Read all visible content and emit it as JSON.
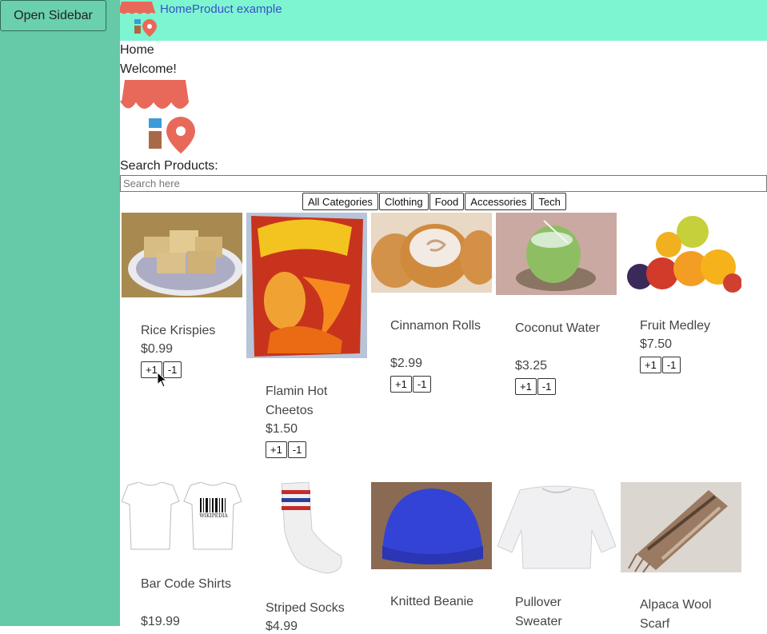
{
  "sidebar": {
    "open_label": "Open Sidebar"
  },
  "header": {
    "title": "HomeProduct example"
  },
  "main": {
    "breadcrumb": "Home",
    "welcome": "Welcome!",
    "search_label": "Search Products:",
    "search_placeholder": "Search here",
    "search_value": ""
  },
  "categories": [
    "All Categories",
    "Clothing",
    "Food",
    "Accessories",
    "Tech"
  ],
  "products": [
    {
      "name": "Rice Krispies",
      "price": "$0.99",
      "plus": "+1",
      "minus": "-1",
      "image": "rice-krispies-photo"
    },
    {
      "name": "Flamin Hot Cheetos",
      "price": "$1.50",
      "plus": "+1",
      "minus": "-1",
      "image": "cheetos-bag-photo"
    },
    {
      "name": "Cinnamon Rolls",
      "price": "$2.99",
      "plus": "+1",
      "minus": "-1",
      "image": "cinnamon-roll-photo"
    },
    {
      "name": "Coconut Water",
      "price": "$3.25",
      "plus": "+1",
      "minus": "-1",
      "image": "coconut-photo"
    },
    {
      "name": "Fruit Medley",
      "price": "$7.50",
      "plus": "+1",
      "minus": "-1",
      "image": "fruit-photo"
    },
    {
      "name": "Bar Code Shirts",
      "price": "$19.99",
      "image": "barcode-shirt-photo",
      "shirt_text": "WIKIPEDIA"
    },
    {
      "name": "Striped Socks",
      "price": "$4.99",
      "image": "striped-sock-photo"
    },
    {
      "name": "Knitted Beanie",
      "image": "beanie-photo"
    },
    {
      "name": "Pullover Sweater",
      "image": "sweater-photo"
    },
    {
      "name": "Alpaca Wool Scarf",
      "image": "scarf-photo"
    }
  ],
  "colors": {
    "sidebar": "#66c9a8",
    "topbar": "#7cf5d0",
    "title": "#3b50c8",
    "awning": "#e8695a"
  }
}
